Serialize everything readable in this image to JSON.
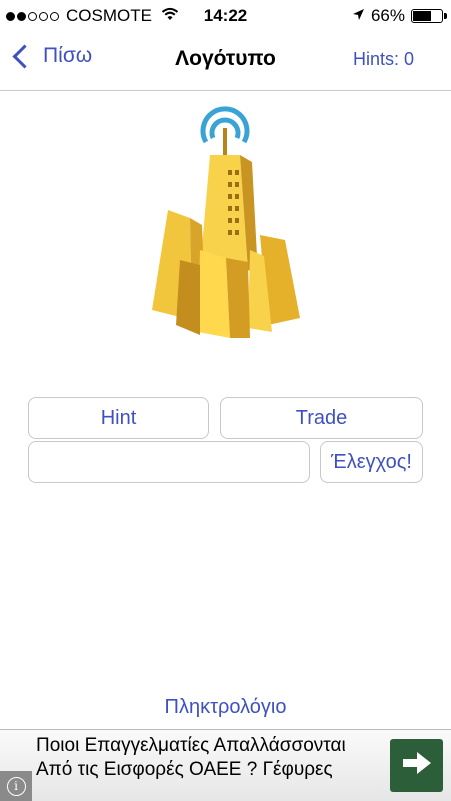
{
  "status_bar": {
    "carrier": "COSMOTE",
    "time": "14:22",
    "battery": "66%",
    "battery_level": 0.66,
    "signal_bars": 2,
    "icons": [
      "signal-dots-icon",
      "wifi-icon",
      "location-arrow-icon",
      "battery-icon"
    ]
  },
  "nav": {
    "back_label": "Πίσω",
    "title": "Λογότυπο",
    "hints": "Hints: 0"
  },
  "logo": {
    "icon": "gold-skyscraper-antenna-logo",
    "colors": {
      "antenna": "#3aa3d6",
      "gold_light": "#f7d24a",
      "gold_mid": "#e6b12a",
      "gold_dark": "#b7841c"
    }
  },
  "buttons": {
    "hint": "Hint",
    "trade": "Trade",
    "check": "Έλεγχος!"
  },
  "answer": {
    "value": "",
    "placeholder": ""
  },
  "keyboard_link": "Πληκτρολόγιο",
  "ad": {
    "text": "Ποιοι Επαγγελματίες Απαλλάσσονται Από τις Εισφορές ΟΑΕΕ ? Γέφυρες",
    "icons": [
      "info-icon",
      "arrow-right-icon"
    ]
  },
  "colors": {
    "accent": "#3f51c0",
    "border": "#c8c7cc"
  }
}
